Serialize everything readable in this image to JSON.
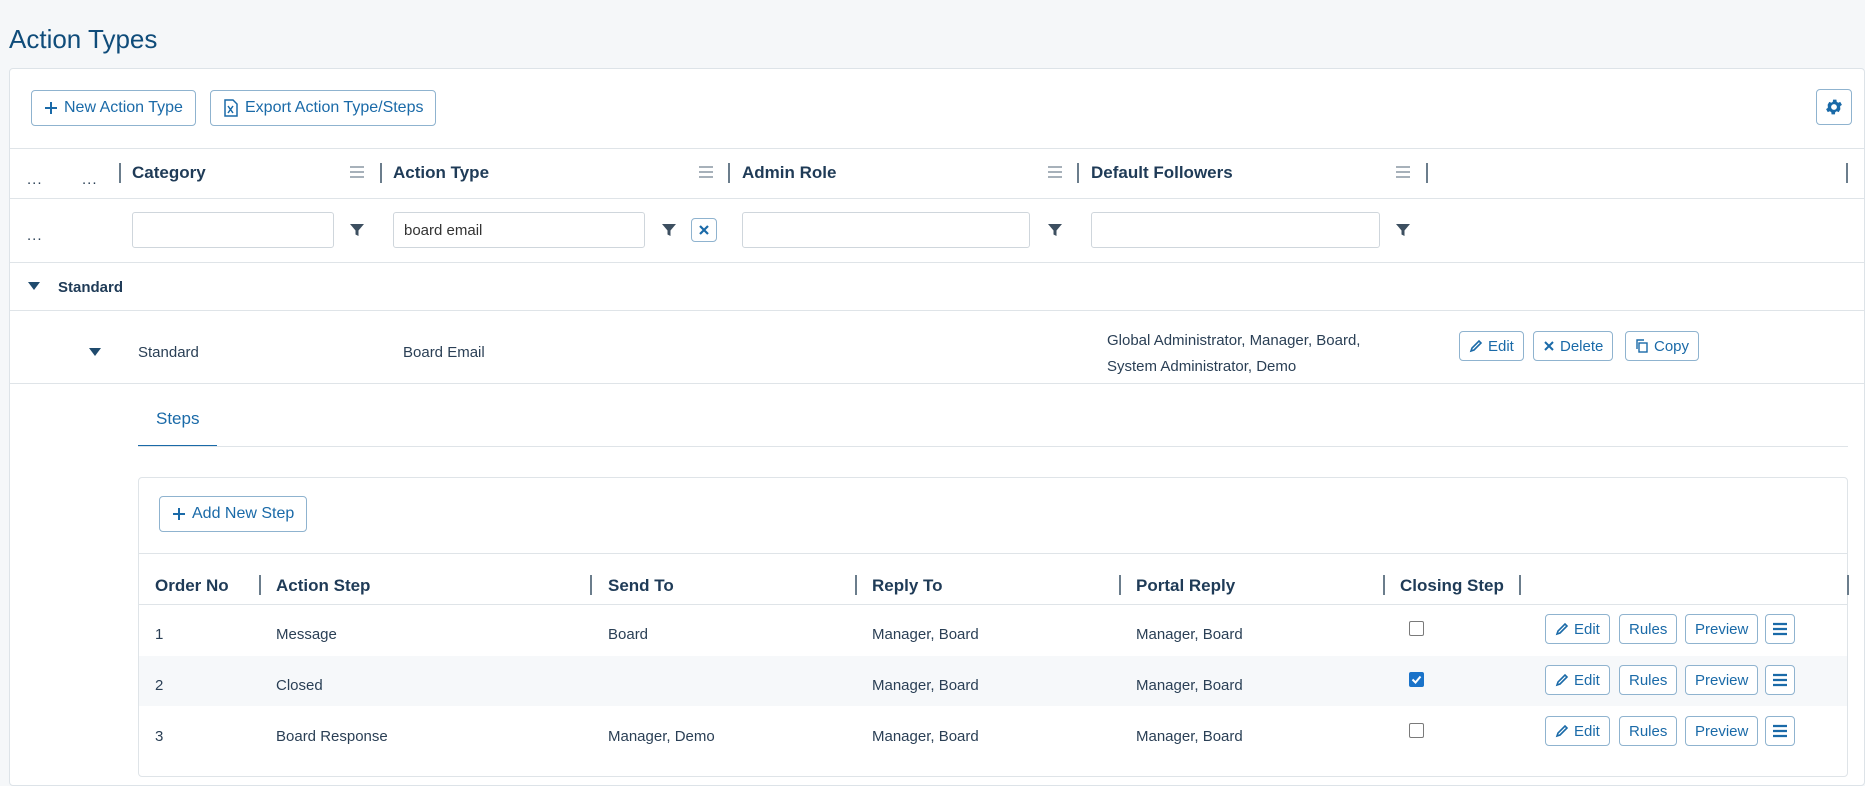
{
  "page": {
    "title": "Action Types"
  },
  "toolbar": {
    "new_action_type": "New Action Type",
    "export_label": "Export Action Type/Steps"
  },
  "grid": {
    "dots": "...",
    "columns": [
      "Category",
      "Action Type",
      "Admin Role",
      "Default Followers"
    ],
    "filters": {
      "category": "",
      "action_type": "board email",
      "admin_role": "",
      "default_followers": ""
    },
    "group_label": "Standard",
    "row": {
      "category": "Standard",
      "action_type": "Board Email",
      "followers_line1": "Global Administrator, Manager, Board,",
      "followers_line2": "System Administrator, Demo",
      "edit": "Edit",
      "delete": "Delete",
      "copy": "Copy"
    }
  },
  "detail": {
    "tab": "Steps",
    "add_step": "Add New Step",
    "columns": [
      "Order No",
      "Action Step",
      "Send To",
      "Reply To",
      "Portal Reply",
      "Closing Step"
    ],
    "steps": [
      {
        "order": "1",
        "step": "Message",
        "send_to": "Board",
        "reply_to": "Manager, Board",
        "portal_reply": "Manager, Board",
        "closing": false
      },
      {
        "order": "2",
        "step": "Closed",
        "send_to": "",
        "reply_to": "Manager, Board",
        "portal_reply": "Manager, Board",
        "closing": true
      },
      {
        "order": "3",
        "step": "Board Response",
        "send_to": "Manager, Demo",
        "reply_to": "Manager, Board",
        "portal_reply": "Manager, Board",
        "closing": false
      }
    ],
    "edit": "Edit",
    "rules": "Rules",
    "preview": "Preview"
  },
  "colors": {
    "accent": "#1a6aa8",
    "title": "#0f4c7a",
    "checkbox": "#1a73c9"
  }
}
